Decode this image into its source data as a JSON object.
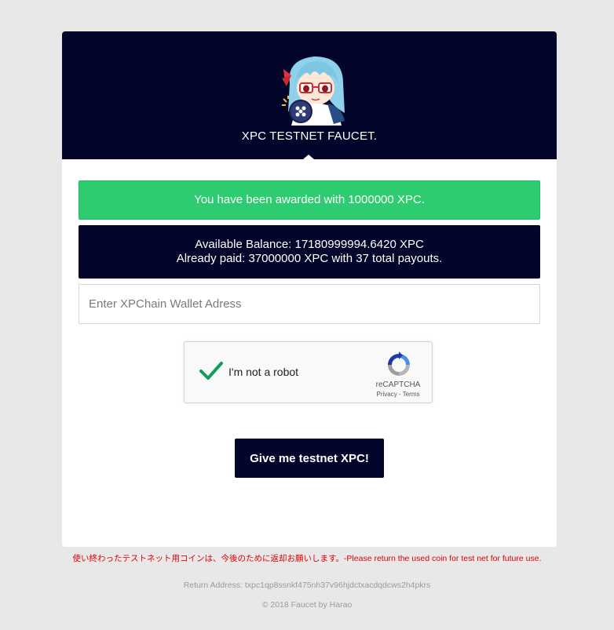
{
  "header": {
    "title": "XPC TESTNET FAUCET.",
    "mascot_icon": "anime-girl-mascot-icon"
  },
  "alert": {
    "message": "You have been awarded with 1000000 XPC.",
    "color": "#2ecc71"
  },
  "balance": {
    "available": "Available Balance: 17180999994.6420 XPC",
    "paid": "Already paid: 37000000 XPC with 37 total payouts."
  },
  "wallet_input": {
    "placeholder": "Enter XPChain Wallet Adress",
    "value": ""
  },
  "recaptcha": {
    "label": "I'm not a robot",
    "brand": "reCAPTCHA",
    "privacy": "Privacy",
    "separator": " - ",
    "terms": "Terms",
    "checked": true,
    "check_icon": "checkmark-icon",
    "logo_icon": "recaptcha-logo-icon"
  },
  "submit": {
    "label": "Give me testnet XPC!"
  },
  "footer": {
    "notice": "使い終わったテストネット用コインは、今後のために返却お願いします。-Please return the used coin for test net for future use.",
    "return_address": "Return Address: txpc1qp8ssnkf475nh37v96hjdctxacdqdcws2h4pkrs",
    "copyright": "© 2018 Faucet by Harao"
  },
  "colors": {
    "navy": "#03052a",
    "success": "#2ecc71",
    "notice_red": "#e00000",
    "page_bg": "#e8e8e8"
  }
}
